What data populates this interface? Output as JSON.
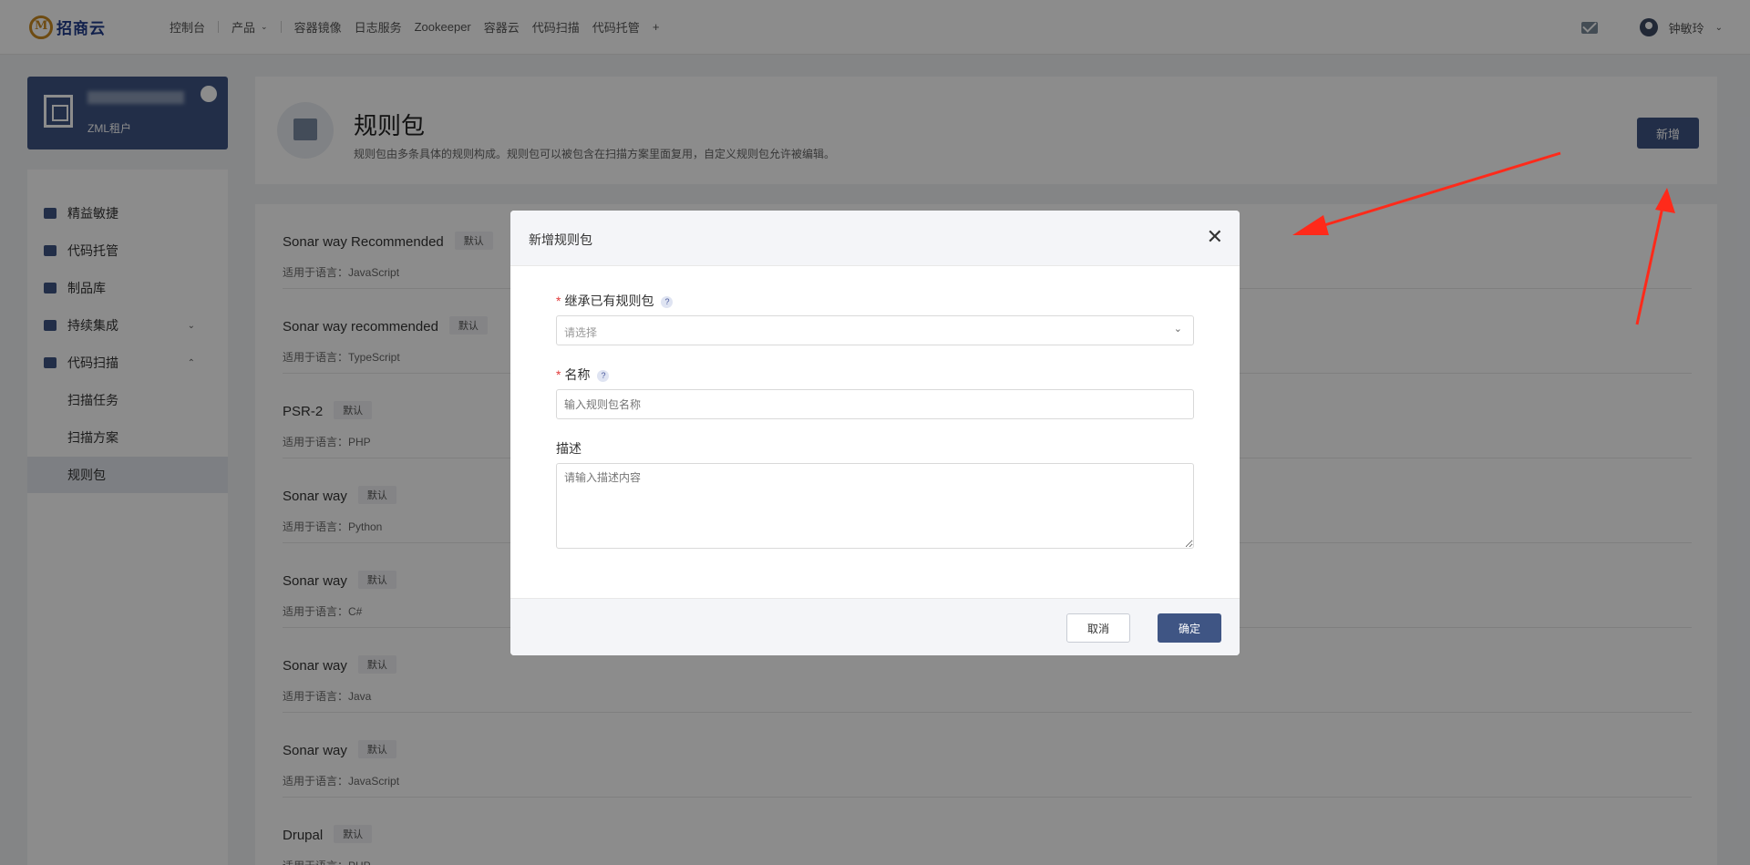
{
  "topbar": {
    "logo_text": "招商云",
    "nav": [
      "控制台",
      "产品",
      "容器镜像",
      "日志服务",
      "Zookeeper",
      "容器云",
      "代码扫描",
      "代码托管"
    ],
    "add_symbol": "+",
    "user_name": "钟敏玲"
  },
  "sidebar": {
    "org_name": "ZML租户",
    "items": [
      {
        "label": "精益敏捷"
      },
      {
        "label": "代码托管"
      },
      {
        "label": "制品库"
      },
      {
        "label": "持续集成"
      },
      {
        "label": "代码扫描"
      },
      {
        "label": "扫描任务"
      },
      {
        "label": "扫描方案"
      },
      {
        "label": "规则包"
      }
    ]
  },
  "page": {
    "title": "规则包",
    "description": "规则包由多条具体的规则构成。规则包可以被包含在扫描方案里面复用，自定义规则包允许被编辑。",
    "new_button": "新增"
  },
  "rule_packages": [
    {
      "name": "Sonar way Recommended",
      "tag": "默认",
      "lang": "适用于语言：JavaScript"
    },
    {
      "name": "Sonar way recommended",
      "tag": "默认",
      "lang": "适用于语言：TypeScript"
    },
    {
      "name": "PSR-2",
      "tag": "默认",
      "lang": "适用于语言：PHP"
    },
    {
      "name": "Sonar way",
      "tag": "默认",
      "lang": "适用于语言：Python"
    },
    {
      "name": "Sonar way",
      "tag": "默认",
      "lang": "适用于语言：C#"
    },
    {
      "name": "Sonar way",
      "tag": "默认",
      "lang": "适用于语言：Java"
    },
    {
      "name": "Sonar way",
      "tag": "默认",
      "lang": "适用于语言：JavaScript"
    },
    {
      "name": "Drupal",
      "tag": "默认",
      "lang": "适用于语言：PHP"
    }
  ],
  "modal": {
    "title": "新增规则包",
    "close_symbol": "✕",
    "inherit_label": "继承已有规则包",
    "inherit_placeholder": "请选择",
    "name_label": "名称",
    "name_placeholder": "输入规则包名称",
    "desc_label": "描述",
    "desc_placeholder": "请输入描述内容",
    "required_mark": "*",
    "help_mark": "?",
    "cancel": "取消",
    "confirm": "确定"
  },
  "colors": {
    "primary": "#3f5584",
    "required": "#e23b3b",
    "annotation_arrow": "#ff2a1a"
  }
}
